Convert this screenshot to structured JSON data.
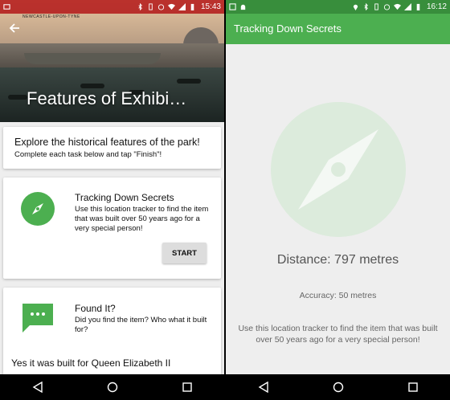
{
  "left": {
    "status": {
      "time": "15:43"
    },
    "hero": {
      "title": "Features of Exhibi…",
      "caption": "NEWCASTLE-UPON-TYNE"
    },
    "intro": {
      "title": "Explore the historical features of the park!",
      "subtitle": "Complete each task below and tap \"Finish\"!"
    },
    "tasks": [
      {
        "title": "Tracking Down Secrets",
        "description": "Use this location tracker to find the item that was built over 50 years ago for a very special person!",
        "button": "START",
        "icon": "compass-icon"
      },
      {
        "title": "Found It?",
        "description": "Did you find the item? Who what it built for?",
        "answer": "Yes it was built for Queen Elizabeth II",
        "icon": "message-icon"
      }
    ]
  },
  "right": {
    "status": {
      "time": "16:12"
    },
    "appbar": {
      "title": "Tracking Down Secrets"
    },
    "distance": "Distance: 797 metres",
    "accuracy": "Accuracy: 50 metres",
    "instructions": "Use this location tracker to find the item that was built over 50 years ago for a very special person!"
  },
  "colors": {
    "accent_green": "#4caf50",
    "dark_green": "#388e3c",
    "status_red": "#b71c1c",
    "compass_bg": "#dcebdc"
  },
  "icons": [
    "back-arrow-icon",
    "compass-icon",
    "message-icon",
    "nav-back-icon",
    "nav-home-icon",
    "nav-recents-icon"
  ]
}
